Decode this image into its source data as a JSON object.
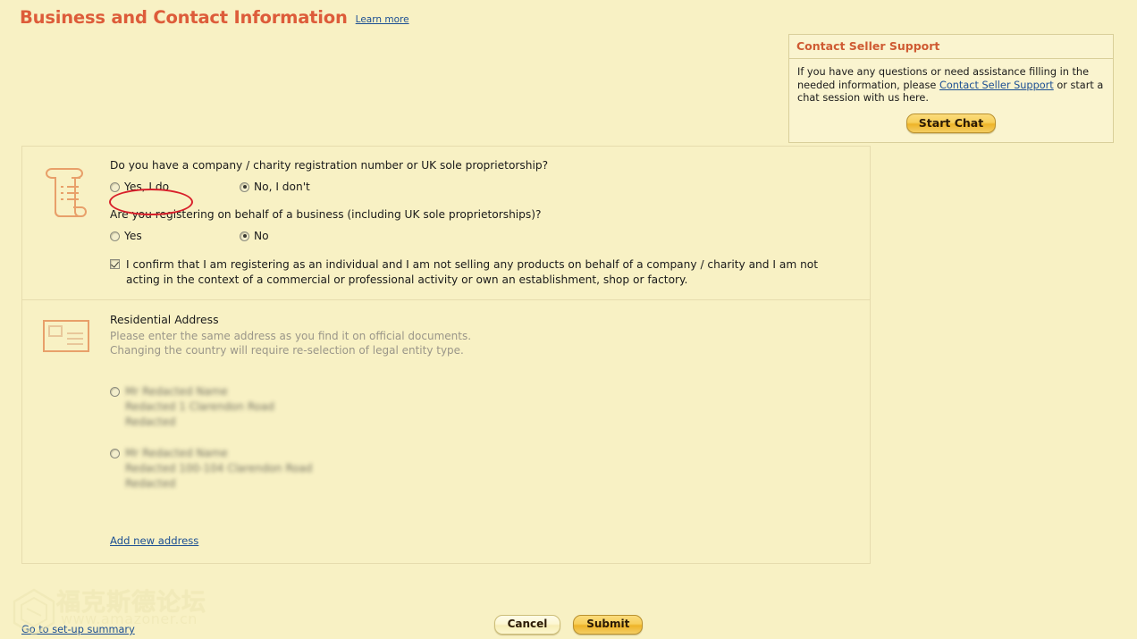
{
  "page": {
    "title": "Business and Contact Information",
    "learn_more_label": "Learn more",
    "accent_color": "#dd5c3a",
    "background_color": "#f8f1c4",
    "link_color": "#1c4f93",
    "highlight_color": "#d81f2a"
  },
  "support": {
    "header": "Contact Seller Support",
    "body_before_link": "If you have any questions or need assistance filling in the needed information, please ",
    "body_link": "Contact Seller Support",
    "body_after_link": " or start a chat session with us here.",
    "start_chat_label": "Start Chat"
  },
  "business_section": {
    "icon": "scroll-document-icon",
    "question_1": "Do you have a company / charity registration number or UK sole proprietorship?",
    "question_1_options": [
      {
        "label": "Yes, I do",
        "checked": false,
        "highlighted": true
      },
      {
        "label": "No, I don't",
        "checked": true,
        "highlighted": false
      }
    ],
    "question_2": "Are you registering on behalf of a business (including UK sole proprietorships)?",
    "question_2_options": [
      {
        "label": "Yes",
        "checked": false
      },
      {
        "label": "No",
        "checked": true
      }
    ],
    "confirm_checked": true,
    "confirm_text": "I confirm that I am registering as an individual and I am not selling any products on behalf of a company / charity and I am not acting in the context of a commercial or professional activity or own an establishment, shop or factory."
  },
  "address_section": {
    "icon": "address-card-icon",
    "title": "Residential Address",
    "subtitle_line_1": "Please enter the same address as you find it on official documents.",
    "subtitle_line_2": "Changing the country will require re-selection of legal entity type.",
    "addresses": [
      {
        "checked": false,
        "redacted": true,
        "line_1": "Mr Redacted Name",
        "line_2": "Redacted 1 Clarendon Road",
        "line_3": "Redacted"
      },
      {
        "checked": false,
        "redacted": true,
        "line_1": "Mr Redacted Name",
        "line_2": "Redacted 100-104 Clarendon Road",
        "line_3": "Redacted"
      }
    ],
    "add_new_address_label": "Add new address"
  },
  "footer": {
    "cancel_label": "Cancel",
    "submit_label": "Submit",
    "setup_summary_label": "Go to set-up summary"
  },
  "watermark": {
    "text_cn": "福克斯德论坛",
    "text_url": "www.amazoner.cn"
  }
}
